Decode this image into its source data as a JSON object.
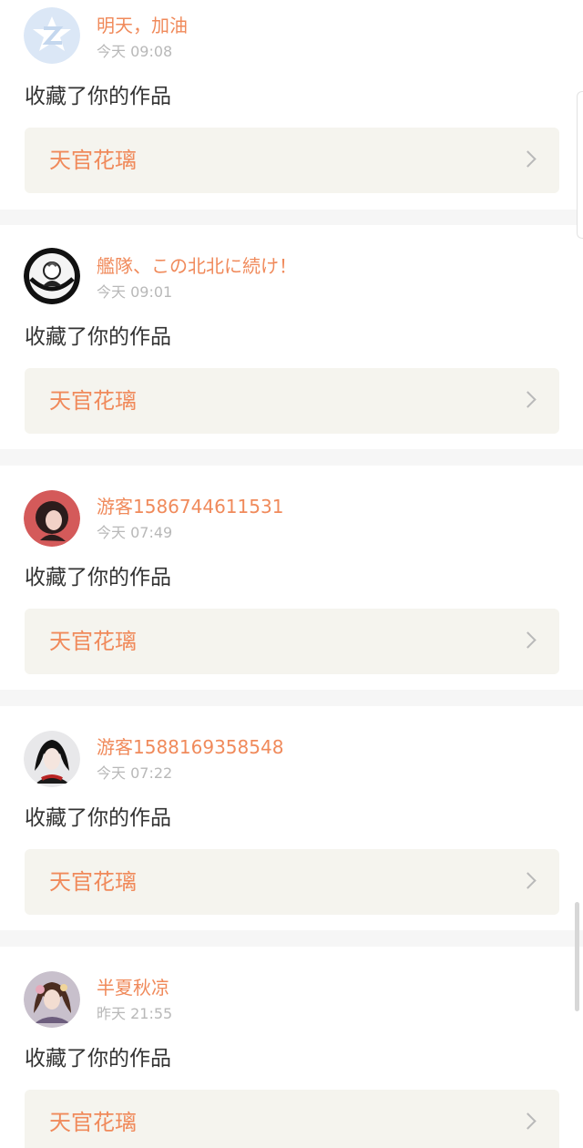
{
  "notifications": [
    {
      "username": "明天，加油",
      "time": "今天 09:08",
      "action": "收藏了你的作品",
      "work_title": "天官花璃",
      "avatar": "default-avatar-icon"
    },
    {
      "username": "艦隊、この北北に続け！",
      "time": "今天 09:01",
      "action": "收藏了你的作品",
      "work_title": "天官花璃",
      "avatar": "anime-character-avatar"
    },
    {
      "username": "游客1586744611531",
      "time": "今天 07:49",
      "action": "收藏了你的作品",
      "work_title": "天官花璃",
      "avatar": "woman-portrait-avatar"
    },
    {
      "username": "游客1588169358548",
      "time": "今天 07:22",
      "action": "收藏了你的作品",
      "work_title": "天官花璃",
      "avatar": "dark-hair-character-avatar"
    },
    {
      "username": "半夏秋凉",
      "time": "昨天 21:55",
      "action": "收藏了你的作品",
      "work_title": "天官花璃",
      "avatar": "costume-character-avatar"
    }
  ],
  "colors": {
    "username": "#f08a5b",
    "work_title": "#f08a5b",
    "time": "#b8b8b8",
    "action": "#333333",
    "work_link_background": "#f5f4ee",
    "separator": "#f6f6f6"
  }
}
